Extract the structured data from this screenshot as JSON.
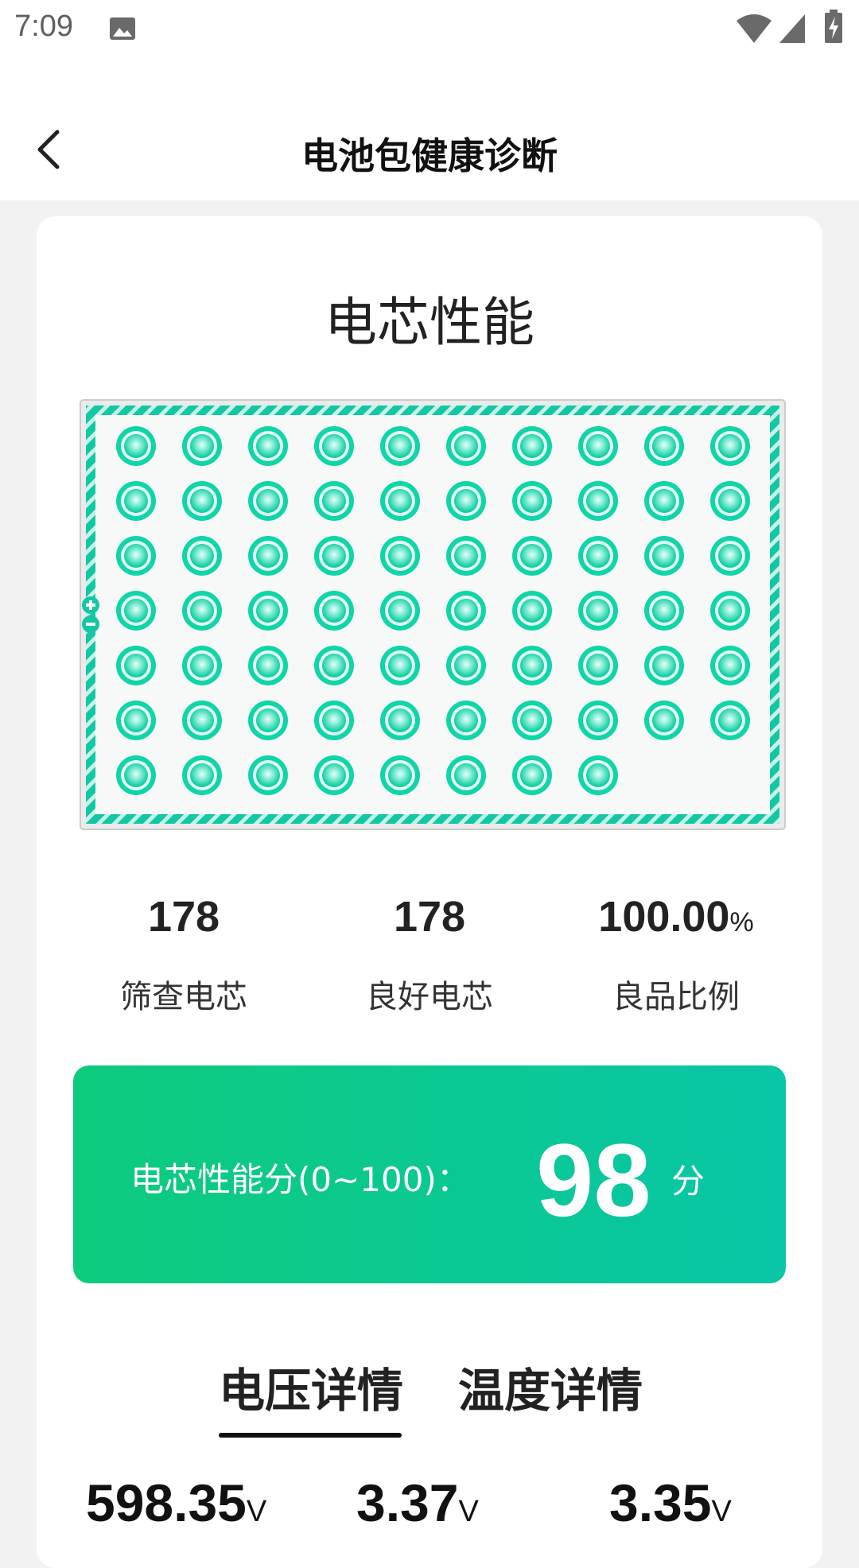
{
  "status_bar": {
    "time": "7:09",
    "icons": [
      "photo-icon",
      "wifi-icon",
      "signal-icon",
      "battery-charging-icon"
    ]
  },
  "nav": {
    "title": "电池包健康诊断",
    "back_icon": "chevron-left-icon"
  },
  "cell_section": {
    "title": "电芯性能",
    "colors": {
      "frame": "#12c7a4",
      "cell": "#0fd5a8",
      "background": "#f7f9f8"
    },
    "grid": {
      "columns": 10,
      "full_rows": 6,
      "last_row_count": 8
    }
  },
  "stats": [
    {
      "value": "178",
      "unit": "",
      "label": "筛查电芯"
    },
    {
      "value": "178",
      "unit": "",
      "label": "良好电芯"
    },
    {
      "value": "100.00",
      "unit": "%",
      "label": "良品比例"
    }
  ],
  "score": {
    "label": "电芯性能分(0~100)：",
    "value": "98",
    "unit": "分"
  },
  "tabs": [
    {
      "label": "电压详情",
      "active": true
    },
    {
      "label": "温度详情",
      "active": false
    }
  ],
  "voltages": [
    {
      "value": "598.35",
      "unit": "V"
    },
    {
      "value": "3.37",
      "unit": "V"
    },
    {
      "value": "3.35",
      "unit": "V"
    }
  ]
}
